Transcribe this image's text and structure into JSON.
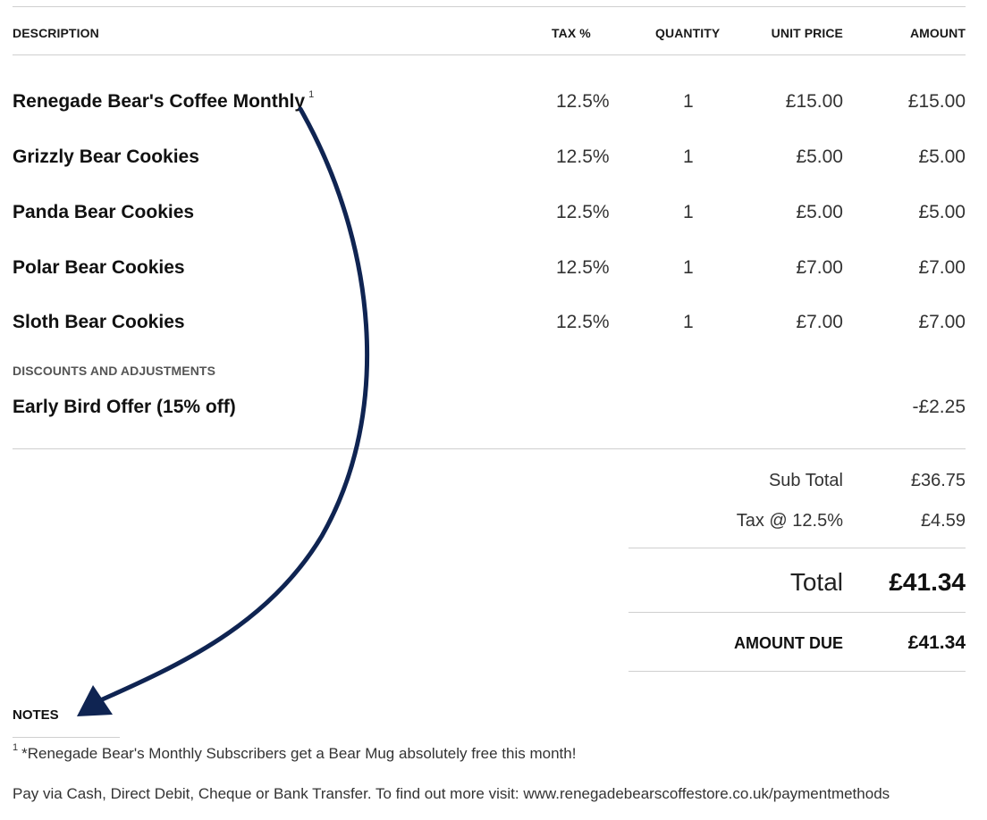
{
  "table": {
    "headers": {
      "description": "DESCRIPTION",
      "tax": "TAX %",
      "quantity": "QUANTITY",
      "unit_price": "UNIT PRICE",
      "amount": "AMOUNT"
    },
    "items": [
      {
        "description": "Renegade Bear's Coffee Monthly",
        "footnote": "1",
        "tax": "12.5%",
        "quantity": "1",
        "unit_price": "£15.00",
        "amount": "£15.00"
      },
      {
        "description": "Grizzly Bear Cookies",
        "footnote": "",
        "tax": "12.5%",
        "quantity": "1",
        "unit_price": "£5.00",
        "amount": "£5.00"
      },
      {
        "description": "Panda Bear Cookies",
        "footnote": "",
        "tax": "12.5%",
        "quantity": "1",
        "unit_price": "£5.00",
        "amount": "£5.00"
      },
      {
        "description": "Polar Bear Cookies",
        "footnote": "",
        "tax": "12.5%",
        "quantity": "1",
        "unit_price": "£7.00",
        "amount": "£7.00"
      },
      {
        "description": "Sloth Bear Cookies",
        "footnote": "",
        "tax": "12.5%",
        "quantity": "1",
        "unit_price": "£7.00",
        "amount": "£7.00"
      }
    ],
    "discounts_label": "DISCOUNTS AND ADJUSTMENTS",
    "discount": {
      "description": "Early Bird Offer (15% off)",
      "amount": "-£2.25"
    }
  },
  "totals": {
    "subtotal_label": "Sub Total",
    "subtotal_value": "£36.75",
    "tax_label": "Tax @ 12.5%",
    "tax_value": "£4.59",
    "total_label": "Total",
    "total_value": "£41.34",
    "amount_due_label": "AMOUNT DUE",
    "amount_due_value": "£41.34"
  },
  "notes": {
    "title": "NOTES",
    "footnote_marker": "1",
    "footnote_text": "*Renegade Bear's Monthly Subscribers get a Bear Mug absolutely free this month!",
    "payment_text": "Pay via Cash, Direct Debit, Cheque or Bank Transfer. To find out more visit: www.renegadebearscoffestore.co.uk/paymentmethods"
  },
  "colors": {
    "arrow": "#0f2452",
    "rule": "#cfcfcf"
  }
}
